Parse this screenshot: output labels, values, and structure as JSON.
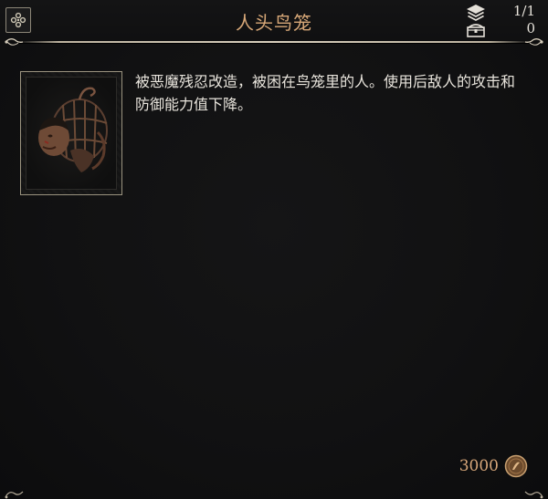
{
  "header": {
    "title": "人头鸟笼",
    "stack_count": "1/1",
    "storage_count": "0",
    "menu_icon": "ornate-menu-icon",
    "stack_icon": "layers-icon",
    "storage_icon": "chest-icon"
  },
  "item": {
    "portrait_icon": "caged-head-icon",
    "description": "被恶魔残忍改造，被困在鸟笼里的人。使用后敌人的攻击和防御能力值下降。"
  },
  "footer": {
    "price": "3000",
    "currency_icon": "gold-coin-icon"
  },
  "colors": {
    "title": "#d8a878",
    "text": "#e8e4dc",
    "price": "#d7a679",
    "background": "#111112",
    "ornament": "#d8cfbd"
  }
}
